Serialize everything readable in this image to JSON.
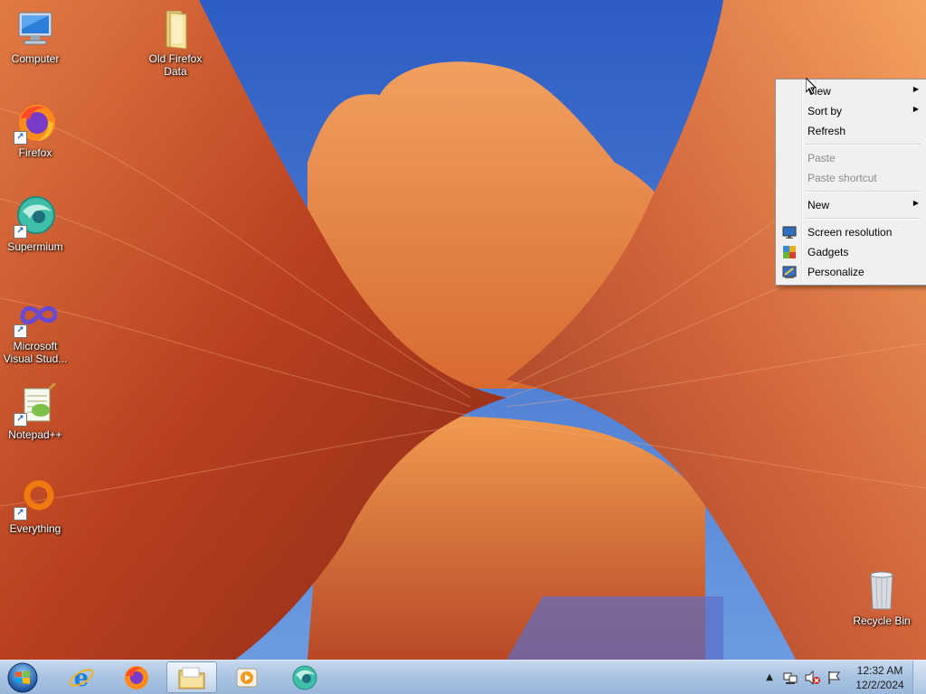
{
  "desktop": {
    "icons": [
      {
        "label": "Computer",
        "icon": "computer-icon"
      },
      {
        "label": "Old Firefox Data",
        "icon": "folder-icon"
      },
      {
        "label": "Firefox",
        "icon": "firefox-icon"
      },
      {
        "label": "Supermium",
        "icon": "supermium-icon"
      },
      {
        "label": "Microsoft Visual Stud...",
        "icon": "visual-studio-icon"
      },
      {
        "label": "Notepad++",
        "icon": "notepadpp-icon"
      },
      {
        "label": "Everything",
        "icon": "everything-icon"
      },
      {
        "label": "Recycle Bin",
        "icon": "recycle-bin-icon"
      }
    ]
  },
  "context_menu": {
    "items": [
      {
        "label": "View",
        "submenu": true,
        "enabled": true
      },
      {
        "label": "Sort by",
        "submenu": true,
        "enabled": true
      },
      {
        "label": "Refresh",
        "submenu": false,
        "enabled": true
      },
      {
        "label": "Paste",
        "submenu": false,
        "enabled": false
      },
      {
        "label": "Paste shortcut",
        "submenu": false,
        "enabled": false
      },
      {
        "label": "New",
        "submenu": true,
        "enabled": true
      },
      {
        "label": "Screen resolution",
        "submenu": false,
        "enabled": true,
        "icon": "screen-resolution-icon"
      },
      {
        "label": "Gadgets",
        "submenu": false,
        "enabled": true,
        "icon": "gadgets-icon"
      },
      {
        "label": "Personalize",
        "submenu": false,
        "enabled": true,
        "icon": "personalize-icon"
      }
    ]
  },
  "taskbar": {
    "pinned": [
      {
        "name": "internet-explorer",
        "icon": "internet-explorer-icon",
        "active": false
      },
      {
        "name": "firefox",
        "icon": "firefox-icon",
        "active": false
      },
      {
        "name": "windows-explorer",
        "icon": "folder-icon",
        "active": true
      },
      {
        "name": "media-player",
        "icon": "media-player-icon",
        "active": false
      },
      {
        "name": "supermium",
        "icon": "supermium-icon",
        "active": false
      }
    ],
    "tray": {
      "icons": [
        "show-hidden-icons-icon",
        "network-icon",
        "volume-muted-icon",
        "action-center-flag-icon"
      ],
      "time": "12:32 AM",
      "date": "12/2/2024"
    }
  },
  "colors": {
    "menu_bg": "#f0f0f0",
    "menu_disabled_text": "#8a8a8a",
    "taskbar_top": "#c7d9ee",
    "sky": "#3b6fd0",
    "rock": "#c24a25"
  }
}
